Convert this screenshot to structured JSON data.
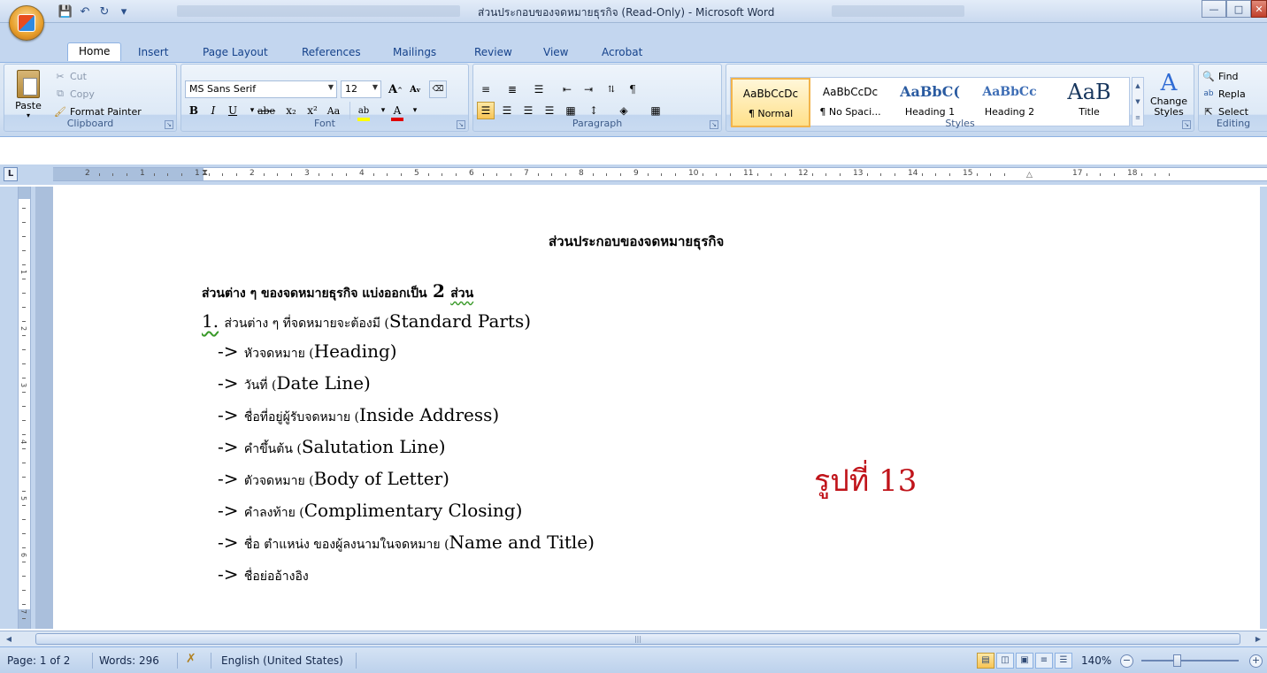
{
  "window": {
    "title": "ส่วนประกอบของจดหมายธุรกิจ (Read-Only) - Microsoft Word",
    "controls": [
      "minimize",
      "maximize",
      "close"
    ]
  },
  "tabs": [
    {
      "label": "Home",
      "active": true
    },
    {
      "label": "Insert"
    },
    {
      "label": "Page Layout"
    },
    {
      "label": "References"
    },
    {
      "label": "Mailings"
    },
    {
      "label": "Review"
    },
    {
      "label": "View"
    },
    {
      "label": "Acrobat"
    }
  ],
  "ribbon": {
    "clipboard": {
      "label": "Clipboard",
      "paste": "Paste",
      "cut": "Cut",
      "copy": "Copy",
      "format_painter": "Format Painter"
    },
    "font": {
      "label": "Font",
      "font_name": "MS Sans Serif",
      "font_size": "12",
      "bold": "B",
      "italic": "I",
      "underline": "U",
      "strike": "abe",
      "subscript": "x₂",
      "superscript": "x²",
      "change_case": "Aa",
      "grow": "A",
      "shrink": "A",
      "highlight": "ab",
      "font_color": "A"
    },
    "paragraph": {
      "label": "Paragraph"
    },
    "styles": {
      "label": "Styles",
      "items": [
        {
          "sample": "AaBbCcDc",
          "name": "¶ Normal"
        },
        {
          "sample": "AaBbCcDc",
          "name": "¶ No Spaci..."
        },
        {
          "sample": "AaBbC(",
          "name": "Heading 1"
        },
        {
          "sample": "AaBbCc",
          "name": "Heading 2"
        },
        {
          "sample": "AaB",
          "name": "Title"
        }
      ],
      "change_styles": "Change Styles"
    },
    "editing": {
      "label": "Editing",
      "find": "Find",
      "replace": "Repla",
      "select": "Select"
    }
  },
  "ruler": {
    "numbers": [
      "2",
      "1",
      "1",
      "2",
      "3",
      "4",
      "5",
      "6",
      "7",
      "8",
      "9",
      "10",
      "11",
      "12",
      "13",
      "14",
      "15",
      "17",
      "18"
    ],
    "vertical_numbers": [
      "1",
      "2",
      "3",
      "4",
      "5",
      "6",
      "7"
    ]
  },
  "document": {
    "title": "ส่วนประกอบของจดหมายธุรกิจ",
    "intro_th": "ส่วนต่าง ๆ ของจดหมายธุรกิจ แบ่งออกเป็น",
    "intro_num": "2",
    "intro_tail": "ส่วน",
    "item1_num": "1.",
    "item1_th": "ส่วนต่าง ๆ ที่จดหมายจะต้องมี (",
    "item1_en": "Standard Parts)",
    "parts": [
      {
        "th": "หัวจดหมาย (",
        "en": "Heading)"
      },
      {
        "th": "วันที่ (",
        "en": "Date Line)"
      },
      {
        "th": "ชื่อที่อยู่ผู้รับจดหมาย (",
        "en": "Inside Address)"
      },
      {
        "th": "คำขึ้นต้น (",
        "en": "Salutation Line)"
      },
      {
        "th": "ตัวจดหมาย (",
        "en": "Body of Letter)"
      },
      {
        "th": "คำลงท้าย (",
        "en": "Complimentary Closing)"
      },
      {
        "th": "ชื่อ ตำแหน่ง ของผู้ลงนามในจดหมาย (",
        "en": "Name and Title)"
      },
      {
        "th": "ชื่อย่ออ้างอิง",
        "en": ""
      }
    ],
    "arrow": "->",
    "figure_label": "รูปที่ 13"
  },
  "statusbar": {
    "page": "Page: 1 of 2",
    "words": "Words: 296",
    "language": "English (United States)",
    "zoom": "140%"
  },
  "colors": {
    "figure_label": "#c0141a",
    "ribbon_bg": "#d4e2f3",
    "squiggle": "#3a9a2a"
  }
}
